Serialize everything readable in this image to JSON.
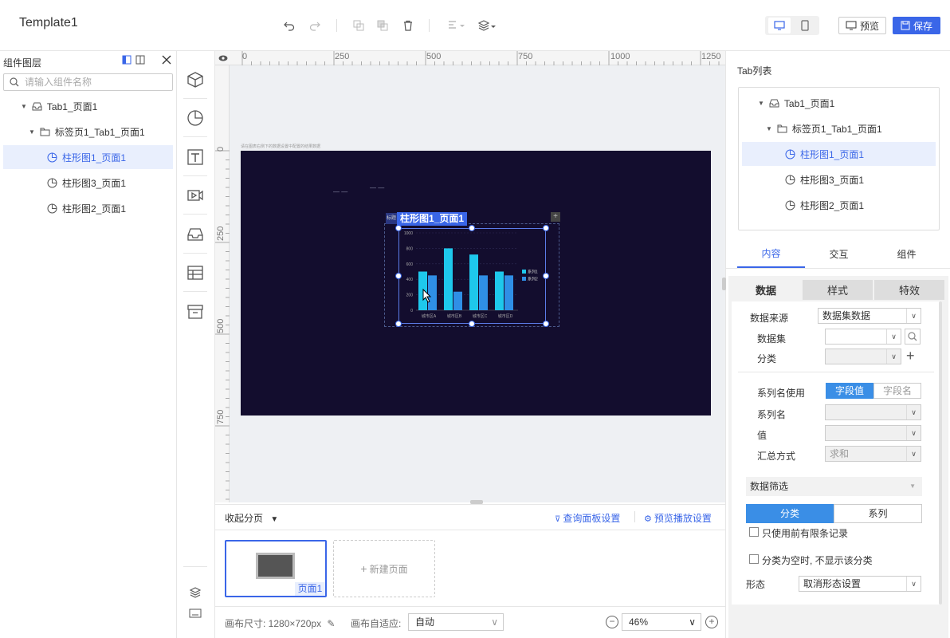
{
  "app": {
    "title": "Template1"
  },
  "toolbar": {
    "preview_label": "预览",
    "save_label": "保存"
  },
  "layers": {
    "title": "组件图层",
    "search_placeholder": "请输入组件名称",
    "items": [
      {
        "label": "Tab1_页面1",
        "level": 0,
        "icon": "tab-icon",
        "expanded": true
      },
      {
        "label": "标签页1_Tab1_页面1",
        "level": 1,
        "icon": "folder-icon",
        "expanded": true
      },
      {
        "label": "柱形图1_页面1",
        "level": 2,
        "icon": "chart-pie-icon",
        "selected": true
      },
      {
        "label": "柱形图3_页面1",
        "level": 2,
        "icon": "chart-pie-icon"
      },
      {
        "label": "柱形图2_页面1",
        "level": 2,
        "icon": "chart-pie-icon"
      }
    ]
  },
  "tools": [
    "cube-icon",
    "pie-chart-icon",
    "text-icon",
    "video-icon",
    "inbox-icon",
    "table-icon",
    "archive-icon"
  ],
  "ruler": {
    "top_labels": [
      "0",
      "250",
      "500",
      "750",
      "1000",
      "1250"
    ],
    "left_labels": [
      "0",
      "250",
      "500",
      "750"
    ]
  },
  "canvas": {
    "selected_component_label": "柱形图1_页面1",
    "small_tag": "标题",
    "caption": "请在图表右侧下的数据设置中配置的结果数据",
    "dash_marks": [
      "— —",
      "— —"
    ]
  },
  "chart_data": {
    "type": "bar",
    "categories": [
      "城市区A",
      "城市区B",
      "城市区C",
      "城市区D"
    ],
    "series": [
      {
        "name": "系列1",
        "values": [
          500,
          800,
          720,
          500
        ],
        "color": "#1ec8ec"
      },
      {
        "name": "系列2",
        "values": [
          450,
          240,
          450,
          450
        ],
        "color": "#2f8fe6"
      }
    ],
    "ylim": [
      0,
      1000
    ],
    "yticks": [
      "1000",
      "800",
      "600",
      "400",
      "200",
      "0"
    ],
    "legend": "right"
  },
  "pages": {
    "collapse_label": "收起分页",
    "query_panel_label": "查询面板设置",
    "preview_play_label": "预览播放设置",
    "page1_label": "页面1",
    "new_page_label": "新建页面"
  },
  "status": {
    "canvas_size": "画布尺寸:  1280×720px",
    "auto_fit_label": "画布自适应:",
    "auto_fit_value": "自动",
    "zoom_value": "46%"
  },
  "right": {
    "tablist_title": "Tab列表",
    "tree": [
      {
        "label": "Tab1_页面1",
        "level": 0,
        "icon": "tab-icon"
      },
      {
        "label": "标签页1_Tab1_页面1",
        "level": 1,
        "icon": "folder-icon"
      },
      {
        "label": "柱形图1_页面1",
        "level": 2,
        "icon": "chart-pie-icon",
        "selected": true
      },
      {
        "label": "柱形图3_页面1",
        "level": 2,
        "icon": "chart-pie-icon"
      },
      {
        "label": "柱形图2_页面1",
        "level": 2,
        "icon": "chart-pie-icon"
      }
    ],
    "tabs": [
      "内容",
      "交互",
      "组件"
    ],
    "subtabs": [
      "数据",
      "样式",
      "特效"
    ],
    "form": {
      "data_source_label": "数据来源",
      "data_source_value": "数据集数据",
      "dataset_label": "数据集",
      "category_label": "分类",
      "series_use_label": "系列名使用",
      "seg_field_value": "字段值",
      "seg_field_name": "字段名",
      "series_name_label": "系列名",
      "value_label": "值",
      "agg_label": "汇总方式",
      "agg_value": "求和",
      "filter_label": "数据筛选",
      "filter_category": "分类",
      "filter_series": "系列",
      "limit_label": "只使用前有限条记录",
      "hide_empty_label": "分类为空时, 不显示该分类",
      "shape_label": "形态",
      "shape_value": "取消形态设置"
    }
  }
}
